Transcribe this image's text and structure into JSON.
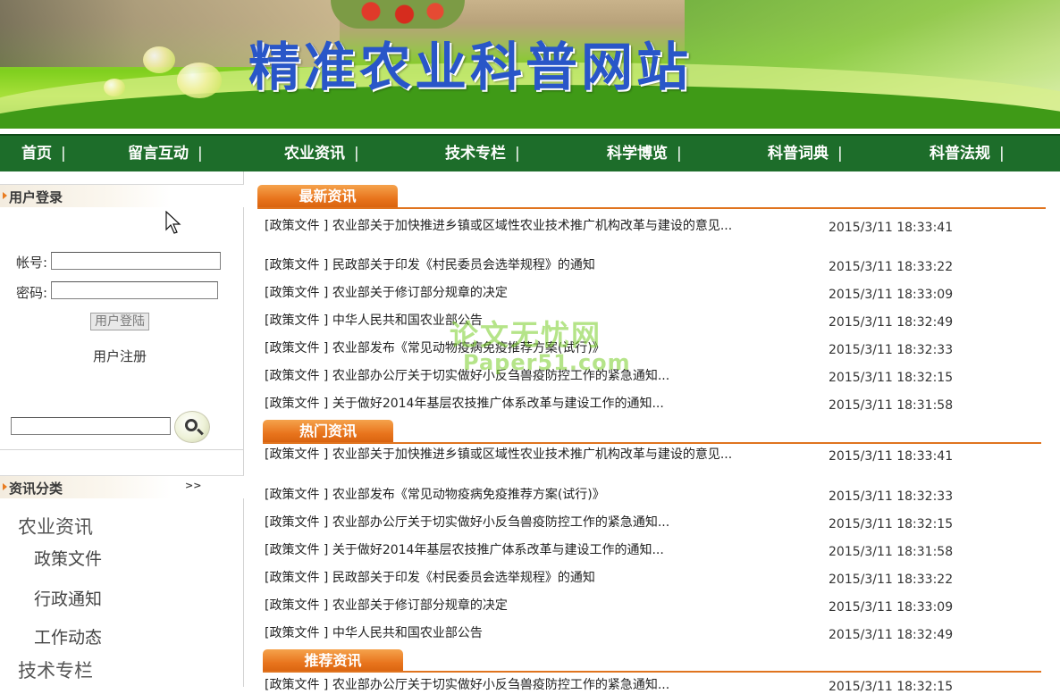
{
  "banner": {
    "title": "精准农业科普网站"
  },
  "nav": {
    "items": [
      {
        "label": "首页",
        "sep": "|"
      },
      {
        "label": "留言互动",
        "sep": "|"
      },
      {
        "label": "农业资讯",
        "sep": "|"
      },
      {
        "label": "技术专栏",
        "sep": "|"
      },
      {
        "label": "科学博览",
        "sep": "|"
      },
      {
        "label": "科普词典",
        "sep": "|"
      },
      {
        "label": "科普法规",
        "sep": "|"
      }
    ]
  },
  "login": {
    "title": "用户登录",
    "account_label": "帐号:",
    "password_label": "密码:",
    "account_value": "",
    "password_value": "",
    "login_button": "用户登陆",
    "register_link": "用户注册",
    "search_value": ""
  },
  "categories": {
    "title": "资讯分类",
    "more": ">>",
    "groups": [
      {
        "label": "农业资讯",
        "items": [
          "政策文件",
          "行政通知",
          "工作动态"
        ]
      },
      {
        "label": "技术专栏",
        "items": []
      }
    ]
  },
  "sections": [
    {
      "title": "最新资讯",
      "news": [
        {
          "title": "[政策文件 ] 农业部关于加快推进乡镇或区域性农业技术推广机构改革与建设的意见...",
          "date": "2015/3/11 18:33:41"
        },
        {
          "title": "[政策文件 ] 民政部关于印发《村民委员会选举规程》的通知",
          "date": "2015/3/11 18:33:22"
        },
        {
          "title": "[政策文件 ] 农业部关于修订部分规章的决定",
          "date": "2015/3/11 18:33:09"
        },
        {
          "title": "[政策文件 ] 中华人民共和国农业部公告",
          "date": "2015/3/11 18:32:49"
        },
        {
          "title": "[政策文件 ] 农业部发布《常见动物疫病免疫推荐方案(试行)》",
          "date": "2015/3/11 18:32:33"
        },
        {
          "title": "[政策文件 ] 农业部办公厅关于切实做好小反刍兽疫防控工作的紧急通知...",
          "date": "2015/3/11 18:32:15"
        },
        {
          "title": "[政策文件 ] 关于做好2014年基层农技推广体系改革与建设工作的通知...",
          "date": "2015/3/11 18:31:58"
        }
      ]
    },
    {
      "title": "热门资讯",
      "news": [
        {
          "title": "[政策文件 ] 农业部关于加快推进乡镇或区域性农业技术推广机构改革与建设的意见...",
          "date": "2015/3/11 18:33:41"
        },
        {
          "title": "[政策文件 ] 农业部发布《常见动物疫病免疫推荐方案(试行)》",
          "date": "2015/3/11 18:32:33"
        },
        {
          "title": "[政策文件 ] 农业部办公厅关于切实做好小反刍兽疫防控工作的紧急通知...",
          "date": "2015/3/11 18:32:15"
        },
        {
          "title": "[政策文件 ] 关于做好2014年基层农技推广体系改革与建设工作的通知...",
          "date": "2015/3/11 18:31:58"
        },
        {
          "title": "[政策文件 ] 民政部关于印发《村民委员会选举规程》的通知",
          "date": "2015/3/11 18:33:22"
        },
        {
          "title": "[政策文件 ] 农业部关于修订部分规章的决定",
          "date": "2015/3/11 18:33:09"
        },
        {
          "title": "[政策文件 ] 中华人民共和国农业部公告",
          "date": "2015/3/11 18:32:49"
        }
      ]
    },
    {
      "title": "推荐资讯",
      "news": [
        {
          "title": "[政策文件 ] 农业部办公厅关于切实做好小反刍兽疫防控工作的紧急通知...",
          "date": "2015/3/11 18:32:15"
        }
      ]
    }
  ],
  "watermark": {
    "line1": "论文无忧网",
    "line2": "Paper51.com"
  },
  "colors": {
    "nav_bg": "#1d6d2a",
    "tab_orange": "#e8741c",
    "title_blue": "#2956c8"
  }
}
